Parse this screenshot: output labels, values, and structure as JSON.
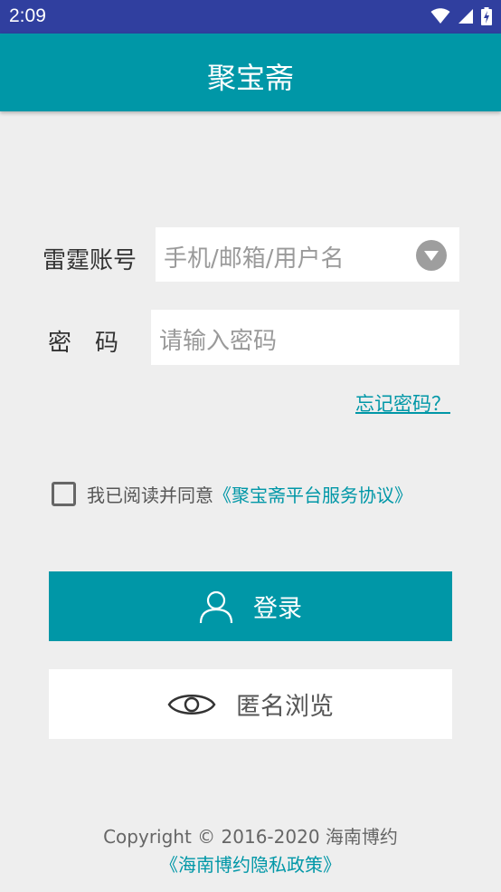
{
  "status_bar": {
    "time": "2:09",
    "icons": [
      "wifi-icon",
      "cell-signal-icon",
      "battery-charging-icon"
    ]
  },
  "app_bar": {
    "title": "聚宝斋"
  },
  "form": {
    "account_label": "雷霆账号",
    "account_placeholder": "手机/邮箱/用户名",
    "password_label": "密　码",
    "password_placeholder": "请输入密码",
    "forgot_password": "忘记密码？"
  },
  "agreement": {
    "checked": false,
    "text": "我已阅读并同意",
    "link": "《聚宝斋平台服务协议》"
  },
  "buttons": {
    "login": "登录",
    "anonymous": "匿名浏览"
  },
  "footer": {
    "copyright": "Copyright © 2016-2020 海南博约",
    "privacy_policy": "《海南博约隐私政策》"
  },
  "colors": {
    "primary": "#0097a7",
    "status_bar": "#303f9f",
    "background": "#eeeeee"
  }
}
